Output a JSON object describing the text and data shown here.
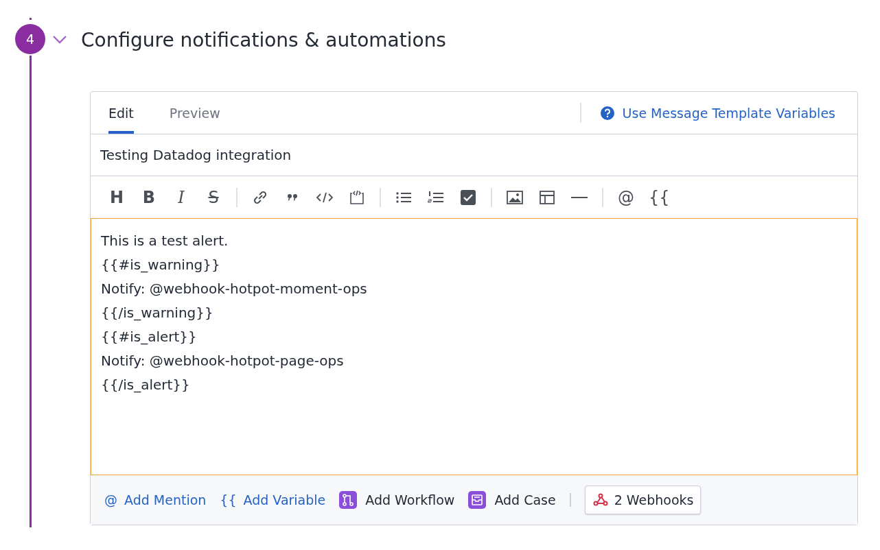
{
  "step": {
    "number": "4",
    "expanded": true,
    "title": "Configure notifications & automations"
  },
  "tabs": [
    {
      "label": "Edit",
      "selected": true
    },
    {
      "label": "Preview",
      "selected": false
    }
  ],
  "help_link": "Use Message Template Variables",
  "message_title": "Testing Datadog integration",
  "toolbar": [
    {
      "kind": "heading",
      "label": "H"
    },
    {
      "kind": "bold",
      "label": "B"
    },
    {
      "kind": "italic",
      "label": "I"
    },
    {
      "kind": "strike",
      "label": "S"
    },
    {
      "kind": "separator"
    },
    {
      "kind": "link"
    },
    {
      "kind": "quote"
    },
    {
      "kind": "code"
    },
    {
      "kind": "embed"
    },
    {
      "kind": "separator"
    },
    {
      "kind": "bullets"
    },
    {
      "kind": "numbers"
    },
    {
      "kind": "checkbox"
    },
    {
      "kind": "separator"
    },
    {
      "kind": "image"
    },
    {
      "kind": "table"
    },
    {
      "kind": "rule"
    },
    {
      "kind": "separator"
    },
    {
      "kind": "mention",
      "label": "@"
    },
    {
      "kind": "variable",
      "label": "{{"
    }
  ],
  "body_lines": [
    "This is a test alert.",
    "{{#is_warning}}",
    "Notify: @webhook-hotpot-moment-ops",
    "{{/is_warning}}",
    "{{#is_alert}}",
    "Notify: @webhook-hotpot-page-ops",
    "{{/is_alert}}"
  ],
  "footer": [
    {
      "kind": "link",
      "glyph": "@",
      "label": "Add Mention"
    },
    {
      "kind": "link",
      "glyph": "{{",
      "label": "Add Variable"
    },
    {
      "kind": "workflow",
      "label": "Add Workflow"
    },
    {
      "kind": "case",
      "label": "Add Case"
    },
    {
      "kind": "separator"
    },
    {
      "kind": "webhooks",
      "label": "2 Webhooks"
    }
  ]
}
